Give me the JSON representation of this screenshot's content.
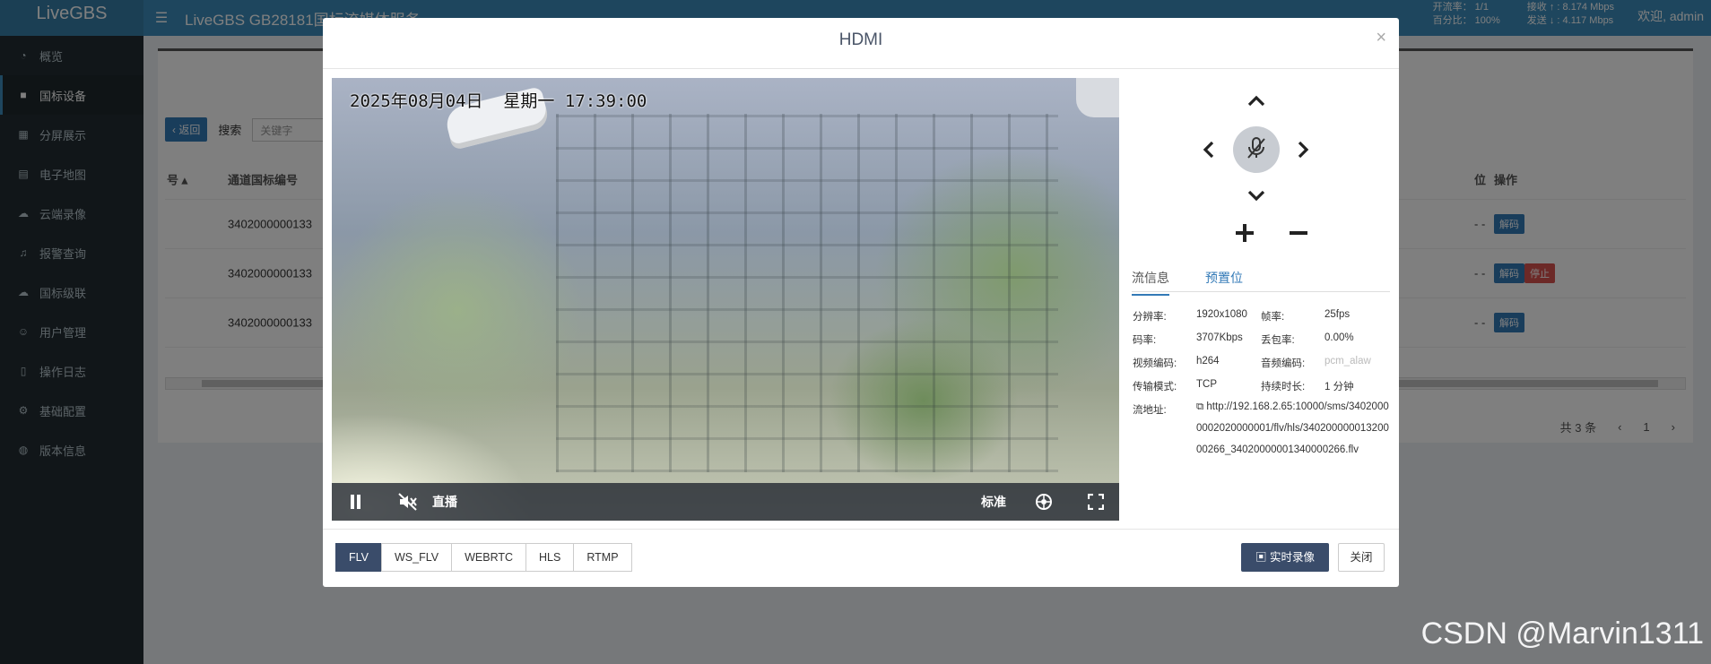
{
  "app": {
    "brand": "LiveGBS",
    "title": "LiveGBS GB28181国标流媒体服务",
    "stats": {
      "open_rate_label": "开流率：",
      "open_rate": "1/1",
      "percent_label": "百分比：",
      "percent": "100%",
      "recv_label": "接收",
      "recv": "8.174 Mbps",
      "send_label": "发送",
      "send": "4.117 Mbps"
    },
    "welcome": "欢迎, admin"
  },
  "sidebar": {
    "items": [
      {
        "label": "概览",
        "icon": "dashboard-icon"
      },
      {
        "label": "国标设备",
        "icon": "video-camera-icon"
      },
      {
        "label": "分屏展示",
        "icon": "grid-icon"
      },
      {
        "label": "电子地图",
        "icon": "map-icon"
      },
      {
        "label": "云端录像",
        "icon": "cloud-icon"
      },
      {
        "label": "报警查询",
        "icon": "bell-icon"
      },
      {
        "label": "国标级联",
        "icon": "cloud-upload-icon"
      },
      {
        "label": "用户管理",
        "icon": "users-icon"
      },
      {
        "label": "操作日志",
        "icon": "file-icon"
      },
      {
        "label": "基础配置",
        "icon": "gears-icon"
      },
      {
        "label": "版本信息",
        "icon": "globe-icon"
      }
    ]
  },
  "background": {
    "back_label": "返回",
    "search_label": "搜索",
    "search_placeholder": "关键字",
    "columns": [
      "号",
      "通道国标编号",
      "位",
      "操作"
    ],
    "rows": [
      {
        "channel": "3402000000133",
        "pos": "- -",
        "actions": [
          "解码"
        ]
      },
      {
        "channel": "3402000000133",
        "pos": "- -",
        "actions": [
          "解码",
          "停止"
        ]
      },
      {
        "channel": "3402000000133",
        "pos": "- -",
        "actions": [
          "解码"
        ]
      }
    ],
    "total": "共 3 条",
    "page": "1"
  },
  "modal": {
    "title": "HDMI",
    "close_symbol": "×",
    "video": {
      "osd_text": "2025年08月04日  星期一 17:39:00",
      "live_label": "直播",
      "quality_label": "标准"
    },
    "tabs": [
      "流信息",
      "预置位"
    ],
    "info": {
      "resolution_label": "分辨率:",
      "resolution": "1920x1080",
      "fps_label": "帧率:",
      "fps": "25fps",
      "bitrate_label": "码率:",
      "bitrate": "3707Kbps",
      "loss_label": "丢包率:",
      "loss": "0.00%",
      "vcodec_label": "视频编码:",
      "vcodec": "h264",
      "acodec_label": "音频编码:",
      "acodec": "pcm_alaw",
      "transport_label": "传输模式:",
      "transport": "TCP",
      "duration_label": "持续时长:",
      "duration": "1 分钟",
      "url_label": "流地址:",
      "url": "http://192.168.2.65:10000/sms/34020000002020000001/flv/hls/34020000001320000266_34020000001340000266.flv"
    },
    "protocols": [
      "FLV",
      "WS_FLV",
      "WEBRTC",
      "HLS",
      "RTMP"
    ],
    "active_protocol": "FLV",
    "record_label": "实时录像",
    "close_label": "关闭"
  },
  "watermark": "CSDN @Marvin1311"
}
